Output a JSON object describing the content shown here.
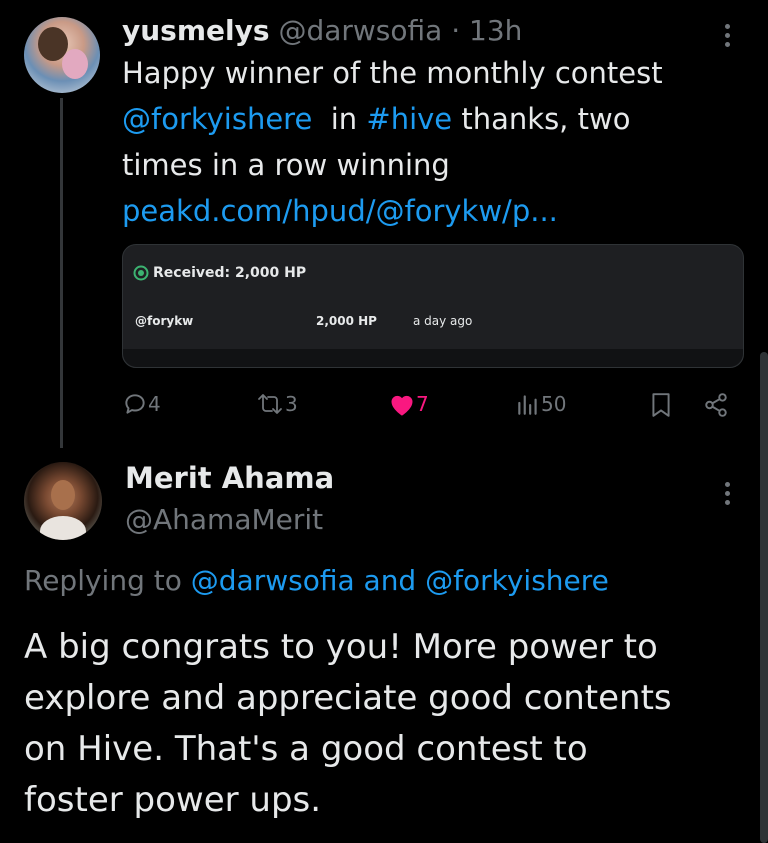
{
  "first_tweet": {
    "display_name": "yusmelys",
    "handle": "@darwsofia",
    "separator": "·",
    "time": "13h",
    "text_line1": "Happy winner of the monthly contest",
    "mention": "@forkyishere",
    "text_in": "in",
    "hashtag": "#hive",
    "text_after_hashtag": "thanks, two",
    "text_line3": "times in a row winning",
    "link": "peakd.com/hpud/@forykw/p...",
    "card": {
      "title": "Received: 2,000 HP",
      "user": "@forykw",
      "amount": "2,000 HP",
      "when": "a day ago"
    },
    "actions": {
      "replies": "4",
      "retweets": "3",
      "likes": "7",
      "views": "50"
    }
  },
  "second_tweet": {
    "display_name": "Merit Ahama",
    "handle": "@AhamaMerit",
    "replying_prefix": "Replying to",
    "replying_user1": "@darwsofia",
    "replying_and": "and",
    "replying_user2": "@forkyishere",
    "text_line1": "A big congrats to you! More power to",
    "text_line2": "explore and appreciate good contents",
    "text_line3": "on Hive. That's a good contest to",
    "text_line4": "foster power ups."
  },
  "colors": {
    "background": "#000000",
    "text": "#e7e9ea",
    "muted": "#71767b",
    "link": "#1d9bf0",
    "like": "#f91880",
    "card_icon": "#3cb371"
  }
}
